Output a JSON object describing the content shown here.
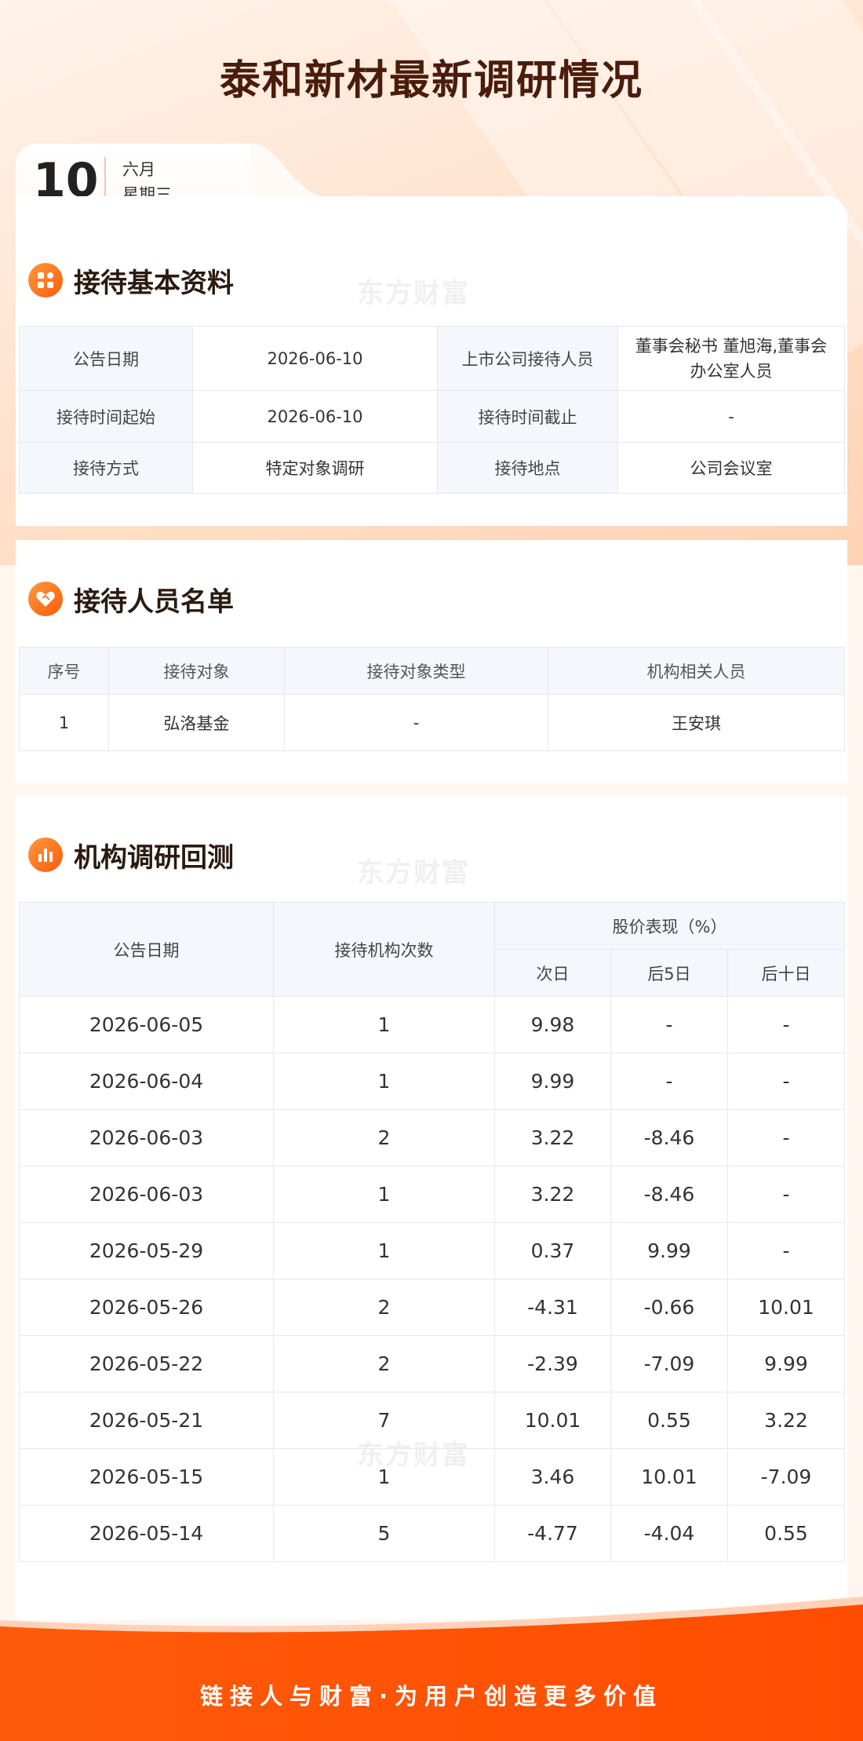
{
  "title": "泰和新材最新调研情况",
  "date": {
    "day": "10",
    "month": "六月",
    "weekday": "星期三"
  },
  "watermark": "东方财富",
  "basic": {
    "heading": "接待基本资料",
    "rows": [
      [
        "公告日期",
        "2026-06-10",
        "上市公司接待人员",
        "董事会秘书 董旭海,董事会办公室人员"
      ],
      [
        "接待时间起始",
        "2026-06-10",
        "接待时间截止",
        "-"
      ],
      [
        "接待方式",
        "特定对象调研",
        "接待地点",
        "公司会议室"
      ]
    ]
  },
  "staff": {
    "heading": "接待人员名单",
    "columns": [
      "序号",
      "接待对象",
      "接待对象类型",
      "机构相关人员"
    ],
    "rows": [
      [
        "1",
        "弘洛基金",
        "-",
        "王安琪"
      ]
    ]
  },
  "backtest": {
    "heading": "机构调研回测",
    "col_date": "公告日期",
    "col_count": "接待机构次数",
    "col_group": "股价表现（%）",
    "sub_columns": [
      "次日",
      "后5日",
      "后十日"
    ],
    "rows": [
      [
        "2026-06-05",
        "1",
        "9.98",
        "-",
        "-"
      ],
      [
        "2026-06-04",
        "1",
        "9.99",
        "-",
        "-"
      ],
      [
        "2026-06-03",
        "2",
        "3.22",
        "-8.46",
        "-"
      ],
      [
        "2026-06-03",
        "1",
        "3.22",
        "-8.46",
        "-"
      ],
      [
        "2026-05-29",
        "1",
        "0.37",
        "9.99",
        "-"
      ],
      [
        "2026-05-26",
        "2",
        "-4.31",
        "-0.66",
        "10.01"
      ],
      [
        "2026-05-22",
        "2",
        "-2.39",
        "-7.09",
        "9.99"
      ],
      [
        "2026-05-21",
        "7",
        "10.01",
        "0.55",
        "3.22"
      ],
      [
        "2026-05-15",
        "1",
        "3.46",
        "10.01",
        "-7.09"
      ],
      [
        "2026-05-14",
        "5",
        "-4.77",
        "-4.04",
        "0.55"
      ]
    ]
  },
  "footer": {
    "slogan": "链接人与财富·为用户创造更多价值"
  },
  "colors": {
    "accent": "#ff5a0a",
    "title": "#4a1c0c",
    "header_bg": "#f4f8fc",
    "border": "#e4e8ee"
  }
}
